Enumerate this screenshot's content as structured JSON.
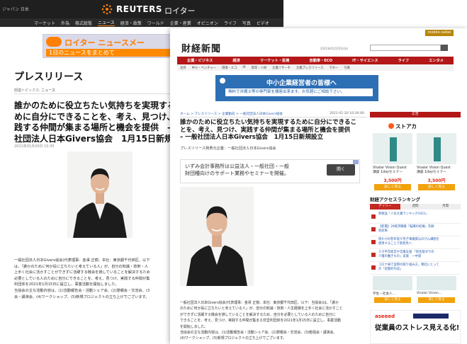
{
  "reuters": {
    "edition": "ジャパン 日本",
    "logo_text": "REUTERS",
    "logo_jp": "ロイター",
    "nav": [
      "マーケット",
      "外為",
      "株式総覧",
      "ニュース",
      "経済・政策",
      "ワールド",
      "企業・産業",
      "オピニオン",
      "ライフ",
      "写真",
      "ビデオ"
    ],
    "active_nav": "ニュース",
    "ad_title": "ロイター ニュースメー",
    "ad_sub": "1日のニュースをまとめて",
    "page_title": "プレスリリース",
    "topics_label": "関連トピックス:",
    "topics_link": "ニュース",
    "headline_lines": [
      "誰かのために役立ちたい気持ちを実現するた",
      "めに自分にできることを、考え、見つけ、実",
      "践する仲間が集まる場所と機会を提供　–",
      "社団法人日本Givers協会　1月15日新規設"
    ],
    "date": "2021年01月20日 10:30",
    "body_lines": [
      "一般社団法人日本Givers協会(代表理事：金澤 正樹、本社：東京都千代田区、以下",
      "は、「誰かのために何か役に立ちたいと考えている人」が、自分の知識・技術・人",
      "上手く社会に活かすことができずに活躍する機会を損していることを解決するため",
      "必要としている人のために自分にできることを、考え、見つけ、実践する仲間が集",
      "利団体を2021年1月15日に設立し、事業活動を開始しました。",
      "当協会の主な活動内容は、(1)活動報告会・活動シェア会、(2)懇親会・交流会、(3",
      "会・講演会、(4)ワークショップ、(5)新規プロジェクトの立ち上げでございます。"
    ]
  },
  "zaikei": {
    "mobile_label": "mobile zaikei",
    "logo": "財経新聞",
    "date": "2021年01月20日(水)",
    "nav": [
      "企業・ビジネス",
      "経済",
      "マーケット・投資",
      "自動車・ECO",
      "IT・サイエンス",
      "ライフ",
      "エンタメ"
    ],
    "subnav": [
      "注目",
      "中小・ベンチャー",
      "環境・エコ",
      "IR",
      "新卒・人材",
      "企業リサーチ",
      "企業プレスリリース",
      "マネー",
      "写真"
    ],
    "ad_title": "中小企業経営者の皆様へ",
    "ad_sub": "無料で弁護士等の専門家を講座出来ます。お気軽にご相談下さい。",
    "breadcrumb": "ホーム > プレスリリース > 企業動向 > 一般社団法人日本Givers協会",
    "crumb_date": "2021-01-20 10:30:00",
    "headline_lines": [
      "誰かのために役立ちたい気持ちを実現するために自分にできるこ",
      "とを、考え、見つけ、実践する仲間が集まる場所と機会を提供",
      "– 一般社団法人日本Givers協会　1月15日新規設立"
    ],
    "source": "プレスリリース発表元企業：一般社団法人日本Givers協会",
    "adbox_lines": [
      "いずみ会計事務所は公益法人・一般社団・一般",
      "財団種向けのサポート業務やセミナーを開催。"
    ],
    "adbox_btn": "開く",
    "body_lines": [
      "一般社団法人日本Givers協会(代表理事：金澤 正樹、本社：東京都千代田区、以下：当協会)は、「誰か",
      "のために何か役に立ちたいと考えている人」が、自分の知識・技術・人生経験を上手く社会に活かすこと",
      "ができずに活躍する機会を損していることを解決するため、自分を必要としている人のために自分に",
      "できることを、考え、見つけ、実践する仲間が集まる非営利団体を2021年1月15日に設立し、事業活動",
      "を開始しました。",
      "当協会の主な活動内容は、(1)活動報告会・活動シェア会、(2)懇親会・交流会、(3)勉強会・講演会、",
      "(4)ワークショップ、(5)新規プロジェクトの立ち上げでございます。"
    ],
    "side": {
      "head": "広告",
      "brand": "ストアカ",
      "products": [
        {
          "name_lines": [
            "Visalar Vision Quest",
            "講座 1dayセミナー"
          ],
          "price": "3,500円",
          "btn": "詳しく見る"
        },
        {
          "name_lines": [
            "Visalar Vision Quest",
            "講座 1dayセミナー"
          ],
          "price": "3,500円",
          "btn": "詳しく見る"
        }
      ],
      "rank_title": "財経アクセスランキング",
      "rank_tabs": [
        "デイリー",
        "週間",
        "月間"
      ],
      "rank_items": [
        [
          "新製品「人気大賞ランキング2021」"
        ],
        [
          "【乾電】26経済職業「転職の結婚」年齢",
          "別結果"
        ],
        [
          "明かかの熟年者が見ぎ事業関与のがん細胞を",
          "使用することで新発見へ"
        ],
        [
          "スタ平年経営や営業支援 「新生取ダウの",
          "介護の働きもの」実施　一中国"
        ],
        [
          "コロナ禍で実際の取り組み方。俺社にとって",
          "の「実態的作成」"
        ]
      ],
      "ad2": [
        {
          "name": "学生・社会人…",
          "btn": "詳しく見る"
        },
        {
          "name": "Visalar Vision…",
          "btn": "詳しく見る"
        }
      ],
      "ad3_brand": "aseeed",
      "ad3_text": "従業員のストレス見える化!"
    }
  }
}
